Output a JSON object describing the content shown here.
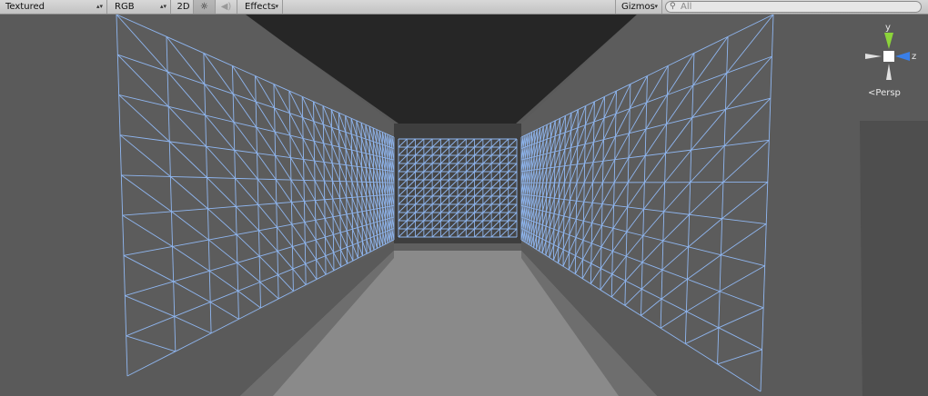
{
  "toolbar": {
    "draw_mode": "Textured",
    "render_mode": "RGB",
    "mode_2d": "2D",
    "lighting_icon": "sun-icon",
    "audio_icon": "speaker-icon",
    "effects_label": "Effects",
    "gizmos_label": "Gizmos",
    "search_placeholder": "All"
  },
  "gizmo": {
    "y_label": "y",
    "z_label": "z",
    "projection_label": "Persp",
    "colors": {
      "y": "#8cd43a",
      "z": "#3a7fe8",
      "x_neutral": "#e0e0e0"
    }
  },
  "scene": {
    "colors": {
      "background": "#5a5a5a",
      "ceiling": "#262626",
      "floor": "#8a8a8a",
      "wall_side": "#6a6a6a",
      "wireframe": "#8fb6f0"
    }
  }
}
